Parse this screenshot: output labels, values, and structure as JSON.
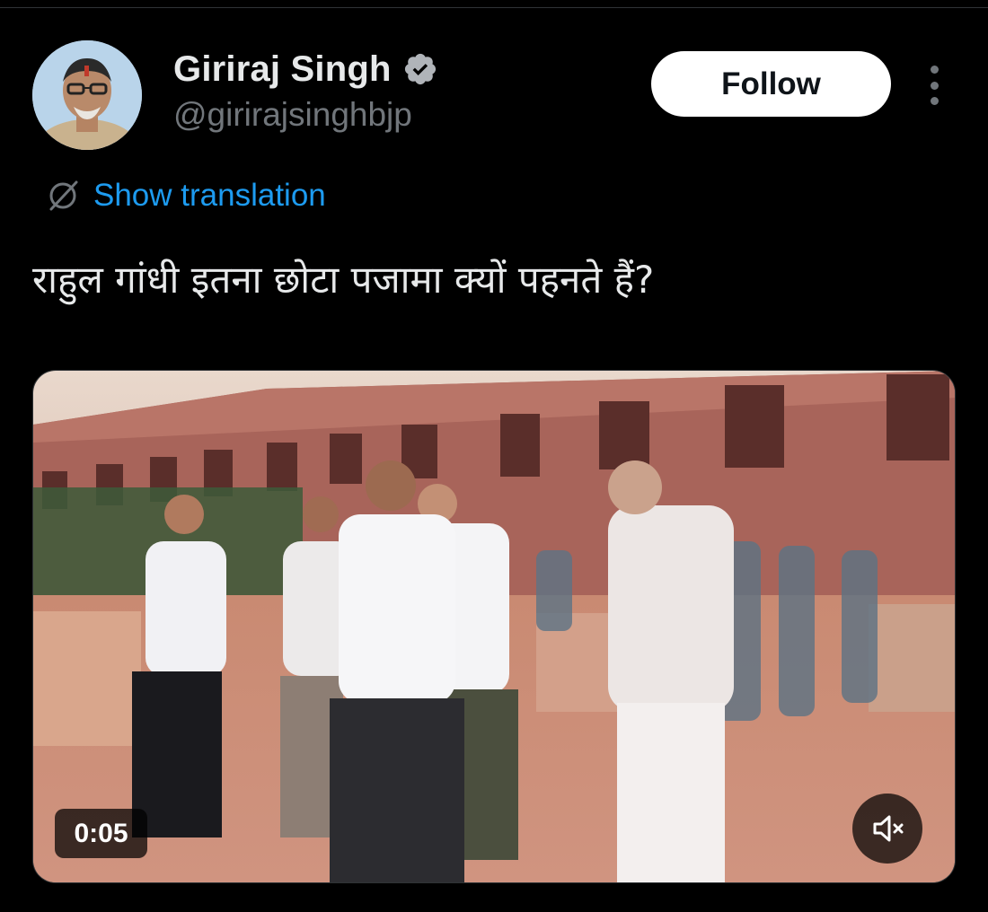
{
  "author": {
    "display_name": "Giriraj Singh",
    "handle": "@girirajsinghbjp",
    "verified": true,
    "verified_icon": "verified-badge-icon"
  },
  "header": {
    "follow_label": "Follow",
    "more_icon": "more-vertical-icon"
  },
  "translation": {
    "icon": "translate-globe-icon",
    "label": "Show translation"
  },
  "tweet": {
    "text": "राहुल गांधी इतना छोटा पजामा क्यों पहनते हैं?"
  },
  "media": {
    "type": "video",
    "duration_label": "0:05",
    "mute_icon": "speaker-muted-icon"
  },
  "colors": {
    "background": "#000000",
    "primary_text": "#e7e9ea",
    "secondary_text": "#71767b",
    "link_blue": "#1d9bf0",
    "follow_button_bg": "#ffffff",
    "follow_button_text": "#0f1419"
  }
}
